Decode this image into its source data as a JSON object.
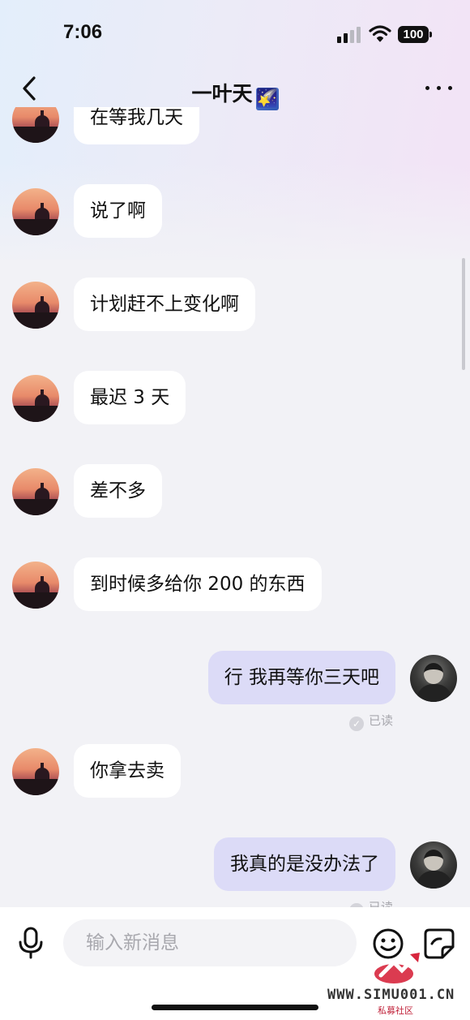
{
  "status_bar": {
    "time": "7:06",
    "battery": "100"
  },
  "nav": {
    "title": "一叶天",
    "title_emoji": "🌠"
  },
  "messages": [
    {
      "side": "left",
      "text": "在等我几天"
    },
    {
      "side": "left",
      "text": "说了啊"
    },
    {
      "side": "left",
      "text": "计划赶不上变化啊"
    },
    {
      "side": "left",
      "text": "最迟 3 天"
    },
    {
      "side": "left",
      "text": "差不多"
    },
    {
      "side": "left",
      "text": "到时候多给你 200 的东西"
    },
    {
      "side": "right",
      "text": "行 我再等你三天吧",
      "status": "已读"
    },
    {
      "side": "left",
      "text": "你拿去卖"
    },
    {
      "side": "right",
      "text": "我真的是没办法了",
      "status": "已读"
    }
  ],
  "input": {
    "placeholder": "输入新消息"
  },
  "watermark": {
    "site": "WWW.SIMU001.CN",
    "label": "私募社区"
  },
  "colors": {
    "bubble_self": "#dcdbf7",
    "bubble_other": "#ffffff",
    "background": "#f2f2f6"
  }
}
